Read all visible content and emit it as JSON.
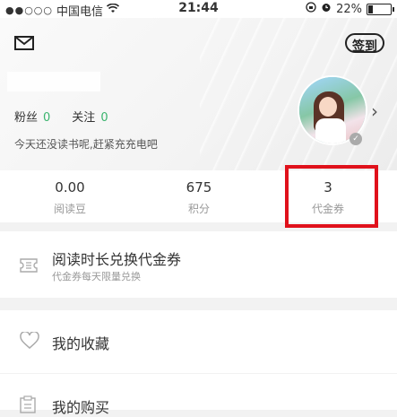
{
  "status_bar": {
    "signal_dots": "●●○○○",
    "carrier": "中国电信",
    "time": "21:44",
    "battery_percent": "22%",
    "battery_level": 0.22
  },
  "header": {
    "signin_label": "签到"
  },
  "profile": {
    "fans_label": "粉丝",
    "fans_count": "0",
    "follow_label": "关注",
    "follow_count": "0",
    "slogan": "今天还没读书呢,赶紧充充电吧"
  },
  "metrics": [
    {
      "value": "0.00",
      "label": "阅读豆"
    },
    {
      "value": "675",
      "label": "积分"
    },
    {
      "value": "3",
      "label": "代金券"
    }
  ],
  "menu": {
    "exchange_title": "阅读时长兑换代金券",
    "exchange_sub": "代金券每天限量兑换",
    "favorites": "我的收藏",
    "purchases": "我的购买"
  },
  "colors": {
    "accent_green": "#3bb46e",
    "highlight_red": "#e0111b"
  }
}
